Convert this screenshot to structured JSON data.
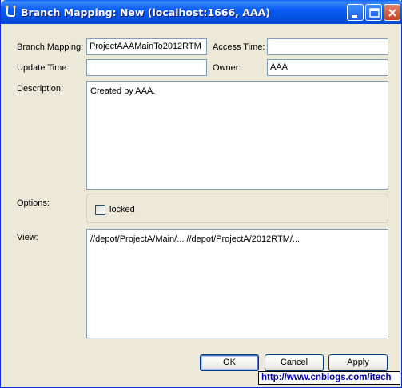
{
  "window": {
    "title": "Branch Mapping: New (localhost:1666, AAA)"
  },
  "form": {
    "branch_mapping_label": "Branch Mapping:",
    "branch_mapping_value": "ProjectAAAMainTo2012RTM",
    "access_time_label": "Access Time:",
    "access_time_value": "",
    "update_time_label": "Update Time:",
    "update_time_value": "",
    "owner_label": "Owner:",
    "owner_value": "AAA",
    "description_label": "Description:",
    "description_value": "Created by AAA.",
    "options_label": "Options:",
    "locked_label": "locked",
    "locked_checked": false,
    "view_label": "View:",
    "view_value": "//depot/ProjectA/Main/... //depot/ProjectA/2012RTM/..."
  },
  "buttons": {
    "ok": "OK",
    "cancel": "Cancel",
    "apply": "Apply"
  },
  "watermark": "http://www.cnblogs.com/itech"
}
